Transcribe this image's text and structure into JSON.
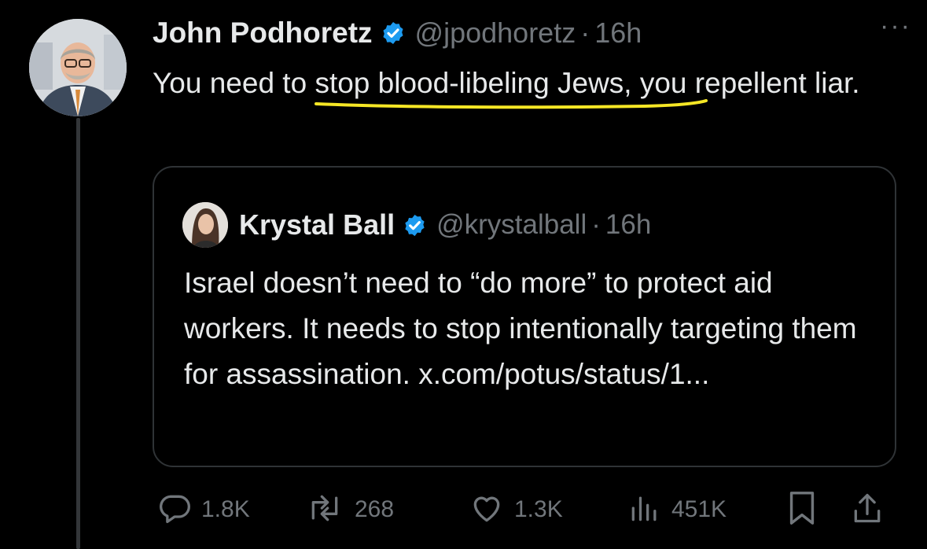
{
  "tweet": {
    "author_name": "John Podhoretz",
    "handle": "@jpodhoretz",
    "separator": "·",
    "time": "16h",
    "more_label": "···",
    "text_before": "You need to ",
    "text_highlight": "stop blood-libeling Jews",
    "text_after": ", you repellent liar.",
    "highlight_color": "#f5e625"
  },
  "quote": {
    "author_name": "Krystal Ball",
    "handle": "@krystalball",
    "separator": "·",
    "time": "16h",
    "text": "Israel doesn’t need to “do more” to protect aid workers. It needs to stop intentionally targeting them for assassination. x.com/potus/status/1..."
  },
  "actions": {
    "replies": "1.8K",
    "reposts": "268",
    "likes": "1.3K",
    "views": "451K"
  },
  "icons": [
    "verified-badge-icon",
    "more-icon",
    "reply-icon",
    "repost-icon",
    "like-icon",
    "views-icon",
    "bookmark-icon",
    "share-icon"
  ],
  "colors": {
    "verified": "#1d9bf0",
    "muted": "#71767b",
    "text": "#e7e9ea",
    "background": "#000000"
  }
}
